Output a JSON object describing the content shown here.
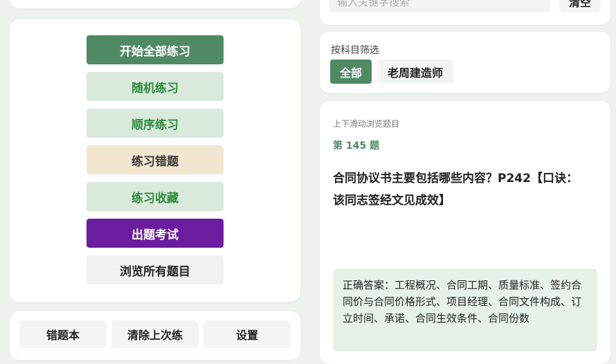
{
  "search": {
    "placeholder": "输入关键字搜索",
    "clear_label": "清空"
  },
  "menu": [
    {
      "label": "开始全部练习",
      "variant": "green"
    },
    {
      "label": "随机练习",
      "variant": "light"
    },
    {
      "label": "顺序练习",
      "variant": "light"
    },
    {
      "label": "练习错题",
      "variant": "beige"
    },
    {
      "label": "练习收藏",
      "variant": "light"
    },
    {
      "label": "出题考试",
      "variant": "purple"
    },
    {
      "label": "浏览所有题目",
      "variant": "gray"
    }
  ],
  "bottom_buttons": [
    "错题本",
    "清除上次练",
    "设置"
  ],
  "filter": {
    "label": "按科目筛选",
    "options": [
      "全部",
      "老周建造师"
    ],
    "selected": "全部"
  },
  "question": {
    "hint": "上下滑动浏览题目",
    "number": "第 145 题",
    "text": "合同协议书主要包括哪些内容？P242【口诀：该同志签经文见成效】",
    "answer": "正确答案：工程概况、合同工期、质量标准、签约合同价与合同价格形式、项目经理、合同文件构成、订立时间、承诺、合同生效条件、合同份数"
  },
  "colors": {
    "accent_green": "#4f8a64",
    "light_green": "#d9eadc",
    "beige": "#f2e6d0",
    "purple": "#6b1da0",
    "background": "#edf2ed"
  }
}
